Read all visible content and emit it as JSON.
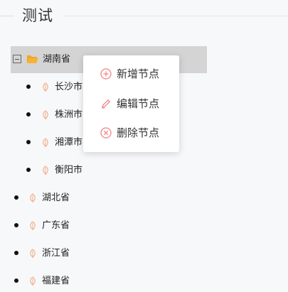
{
  "page": {
    "title": "测试"
  },
  "tree": {
    "expanded_node": {
      "label": "湖南省",
      "children": [
        {
          "label": "长沙市"
        },
        {
          "label": "株洲市"
        },
        {
          "label": "湘潭市"
        },
        {
          "label": "衡阳市"
        }
      ]
    },
    "other_nodes": [
      {
        "label": "湖北省"
      },
      {
        "label": "广东省"
      },
      {
        "label": "浙江省"
      },
      {
        "label": "福建省"
      }
    ]
  },
  "context_menu": {
    "items": [
      {
        "label": "新增节点",
        "icon": "plus-circle-icon"
      },
      {
        "label": "编辑节点",
        "icon": "pencil-icon"
      },
      {
        "label": "删除节点",
        "icon": "close-circle-icon"
      }
    ]
  },
  "colors": {
    "accent": "#f08585",
    "folder": "#f5a623",
    "leaf": "#f3b08c",
    "selected_row": "#d4d4d4"
  }
}
